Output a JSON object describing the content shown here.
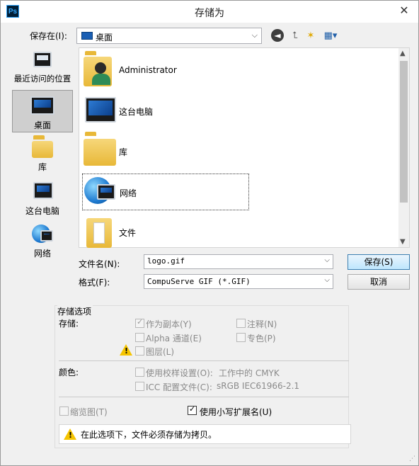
{
  "window": {
    "title": "存储为",
    "app_icon_text": "Ps",
    "close_label": "✕"
  },
  "savein": {
    "label": "保存在(I):",
    "value": "桌面"
  },
  "toolbar": {
    "back": "back-icon",
    "up": "up-folder-icon",
    "new_folder": "new-folder-icon",
    "view_menu": "view-menu-icon"
  },
  "places": [
    {
      "label": "最近访问的位置",
      "icon": "recent-places-icon"
    },
    {
      "label": "桌面",
      "icon": "desktop-icon",
      "selected": true
    },
    {
      "label": "库",
      "icon": "libraries-icon"
    },
    {
      "label": "这台电脑",
      "icon": "this-pc-icon"
    },
    {
      "label": "网络",
      "icon": "network-icon"
    }
  ],
  "files": [
    {
      "label": "Administrator",
      "icon": "user-folder-icon"
    },
    {
      "label": "这台电脑",
      "icon": "this-pc-icon"
    },
    {
      "label": "库",
      "icon": "libraries-icon"
    },
    {
      "label": "网络",
      "icon": "network-icon",
      "focused": true
    },
    {
      "label": "文件",
      "icon": "folder-icon"
    }
  ],
  "filename": {
    "label": "文件名(N):",
    "value": "logo.gif"
  },
  "format": {
    "label": "格式(F):",
    "value": "CompuServe GIF (*.GIF)"
  },
  "buttons": {
    "save": "保存(S)",
    "cancel": "取消"
  },
  "options": {
    "title": "存储选项",
    "storage_label": "存储:",
    "as_copy": "作为副本(Y)",
    "notes": "注释(N)",
    "alpha": "Alpha 通道(E)",
    "spot": "专色(P)",
    "layers": "图层(L)",
    "color_label": "颜色:",
    "proof": "使用校样设置(O):",
    "proof_value": "工作中的 CMYK",
    "icc": "ICC 配置文件(C):",
    "icc_value": "sRGB IEC61966-2.1",
    "thumbnail": "缩览图(T)",
    "lowercase_ext": "使用小写扩展名(U)",
    "notice": "在此选项下，文件必须存储为拷贝。"
  }
}
